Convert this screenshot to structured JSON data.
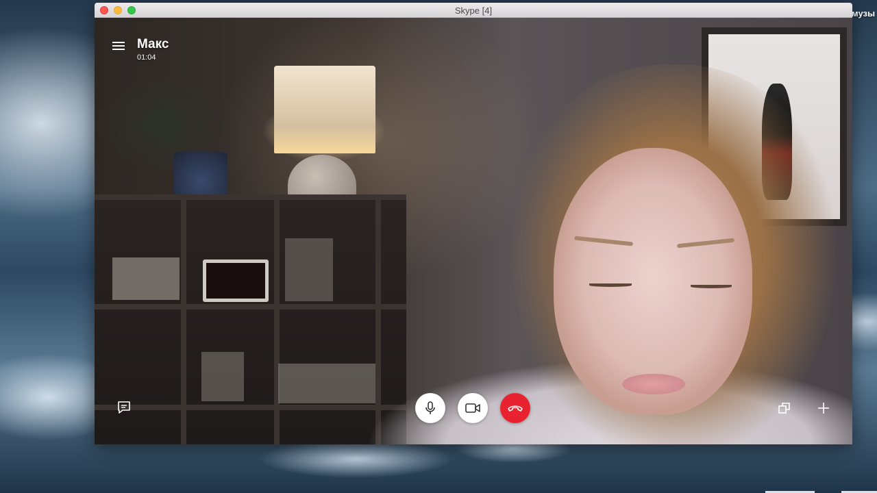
{
  "window": {
    "title": "Skype [4]"
  },
  "desktop": {
    "menubar_fragment": "музы"
  },
  "call": {
    "contact_name": "Макс",
    "duration": "01:04"
  },
  "controls": {
    "menu_icon": "hamburger-menu-icon",
    "chat_icon": "chat-bubble-icon",
    "mic_icon": "microphone-icon",
    "camera_icon": "video-camera-icon",
    "hangup_icon": "phone-hangup-icon",
    "layout_icon": "switch-layout-icon",
    "add_icon": "plus-icon"
  },
  "colors": {
    "hangup": "#e8232f",
    "control_bg": "#ffffff"
  }
}
